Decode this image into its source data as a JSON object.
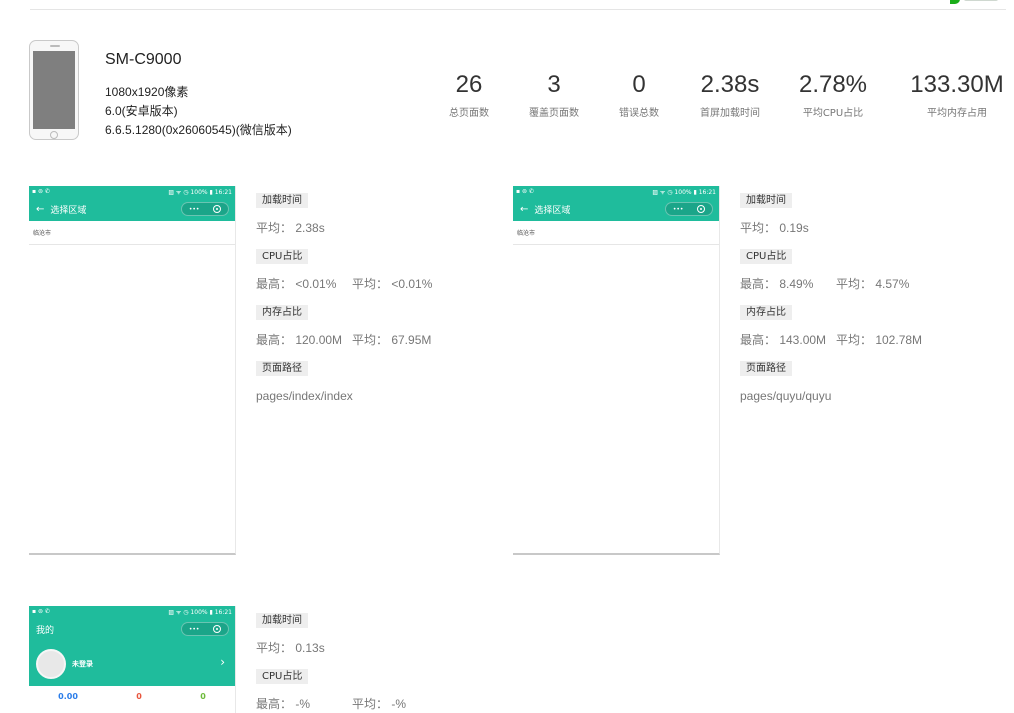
{
  "device": {
    "model": "SM-C9000",
    "resolution": "1080x1920像素",
    "os": "6.0(安卓版本)",
    "wechat": "6.6.5.1280(0x26060545)(微信版本)"
  },
  "stats": [
    {
      "value": "26",
      "label": "总页面数"
    },
    {
      "value": "3",
      "label": "覆盖页面数"
    },
    {
      "value": "0",
      "label": "错误总数"
    },
    {
      "value": "2.38s",
      "label": "首屏加载时间"
    },
    {
      "value": "2.78%",
      "label": "平均CPU占比"
    },
    {
      "value": "133.30M",
      "label": "平均内存占用"
    }
  ],
  "labels": {
    "load": "加载时间",
    "cpu": "CPU占比",
    "mem": "内存占比",
    "path": "页面路径"
  },
  "pages": [
    {
      "shot": {
        "status_left": "▪ ⊚ ✆",
        "status_right": "▨ ᯤ ◷ 100% ▮ 16:21",
        "back": "←",
        "nav_title": "选择区域",
        "capsule_dots": "•••",
        "region": "临沧市"
      },
      "load": "平均：  2.38s",
      "cpu_max": "最高：  <0.01%",
      "cpu_avg": "平均：  <0.01%",
      "mem_max": "最高：  120.00M",
      "mem_avg": "平均：  67.95M",
      "path": "pages/index/index"
    },
    {
      "shot": {
        "status_left": "▪ ⊚ ✆",
        "status_right": "▨ ᯤ ◷ 100% ▮ 16:21",
        "back": "←",
        "nav_title": "选择区域",
        "capsule_dots": "•••",
        "region": "临沧市"
      },
      "load": "平均：  0.19s",
      "cpu_max": "最高：  8.49%",
      "cpu_avg": "平均：  4.57%",
      "mem_max": "最高：  143.00M",
      "mem_avg": "平均：  102.78M",
      "path": "pages/quyu/quyu"
    },
    {
      "shot": {
        "status_left": "▪ ⊚ ✆",
        "status_right": "▨ ᯤ ◷ 100% ▮ 16:21",
        "nav_title": "我的",
        "capsule_dots": "•••",
        "login": "未登录",
        "chevron": "›",
        "stat_a": "0.00",
        "stat_b": "0",
        "stat_c": "0"
      },
      "load": "平均：  0.13s",
      "cpu_max": "最高：  -%",
      "cpu_avg": "平均：  -%"
    }
  ],
  "colors": {
    "theme": "#1fbc9c",
    "tag_bg": "#eeeeee"
  }
}
